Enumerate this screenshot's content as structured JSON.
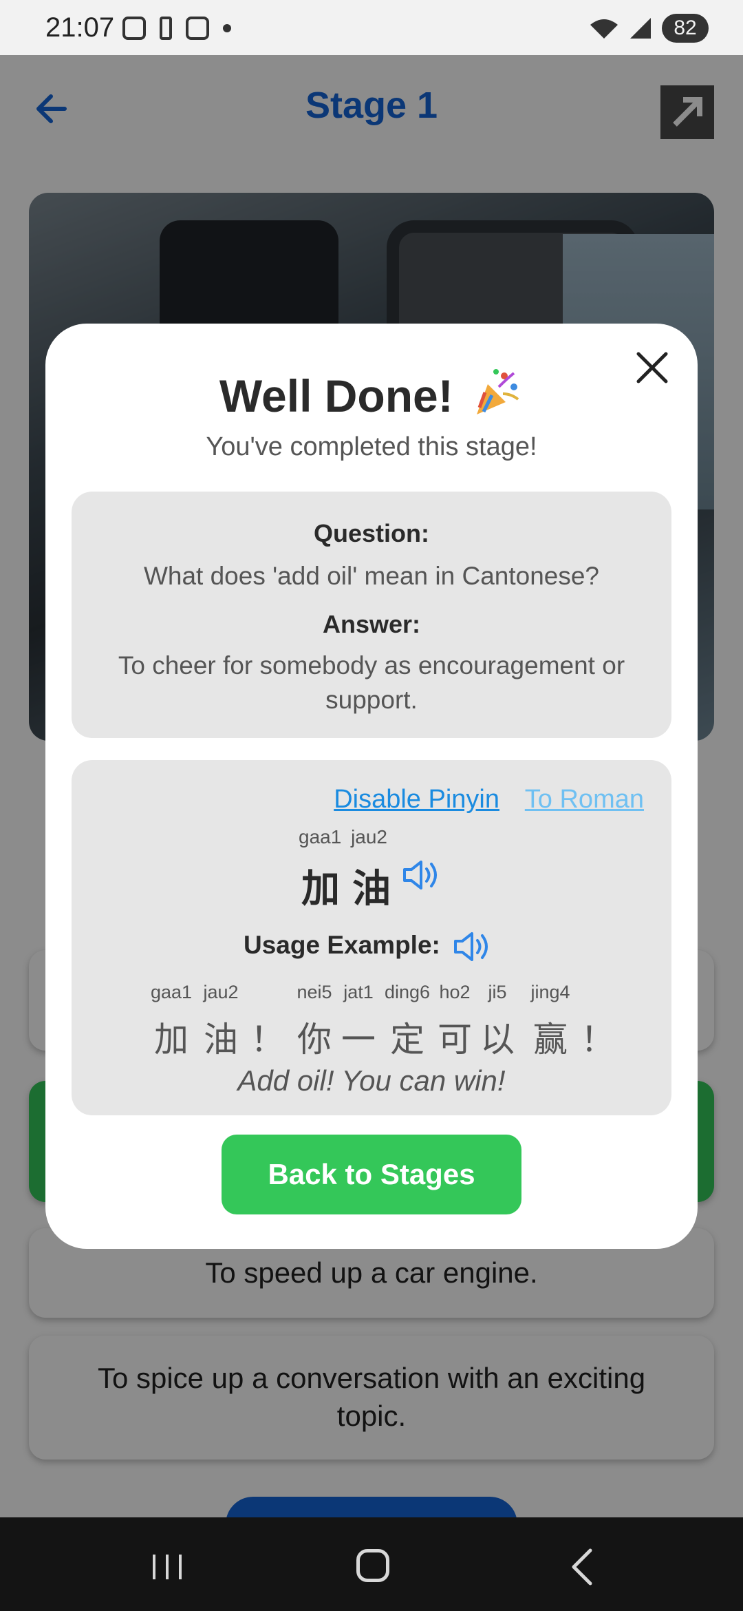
{
  "status_bar": {
    "time": "21:07",
    "battery": "82"
  },
  "header": {
    "title": "Stage 1"
  },
  "options": [
    "",
    "",
    "To speed up a car engine.",
    "To spice up a conversation with an exciting topic."
  ],
  "modal": {
    "title": "Well Done!",
    "subtitle": "You've completed this stage!",
    "question_label": "Question:",
    "question": "What does 'add oil' mean in Cantonese?",
    "answer_label": "Answer:",
    "answer": "To cheer for somebody as encouragement or support.",
    "disable_pinyin": "Disable Pinyin",
    "to_roman": "To Roman",
    "word": {
      "roman": "gaa1 jau2",
      "chars": "加油"
    },
    "usage_label": "Usage Example:",
    "example": {
      "tokens": [
        {
          "roman": "gaa1",
          "char": "加"
        },
        {
          "roman": "jau2",
          "char": "油"
        },
        {
          "roman": "",
          "char": "！"
        },
        {
          "roman": "nei5",
          "char": "你"
        },
        {
          "roman": "jat1",
          "char": "一"
        },
        {
          "roman": "ding6",
          "char": "定"
        },
        {
          "roman": "ho2",
          "char": "可"
        },
        {
          "roman": "ji5",
          "char": "以"
        },
        {
          "roman": "jing4",
          "char": "赢"
        },
        {
          "roman": "",
          "char": "！"
        }
      ],
      "translation": "Add oil! You can win!"
    },
    "back_button": "Back to Stages"
  },
  "colors": {
    "accent_blue": "#1565d8",
    "success_green": "#34c759",
    "link_blue": "#1a8be0",
    "link_light_blue": "#6fc0f2"
  },
  "icons": {
    "back": "arrow-left-icon",
    "share": "external-link-icon",
    "close": "close-icon",
    "celebrate": "party-popper-icon",
    "speaker": "speaker-icon"
  }
}
